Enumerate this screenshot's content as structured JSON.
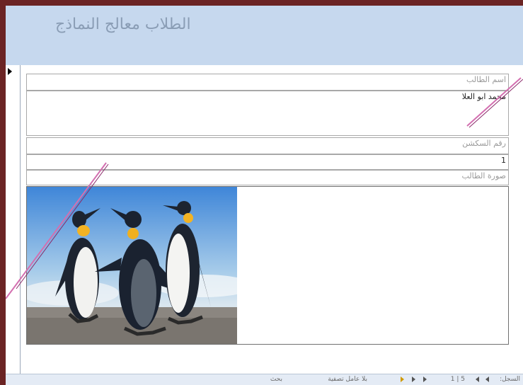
{
  "form": {
    "title": "الطلاب معالج النماذج",
    "fields": [
      {
        "label": "اسم الطالب",
        "value": "محمد ابو العلا"
      },
      {
        "label": "رقم السكشن",
        "value": "1"
      },
      {
        "label": "صورة الطالب"
      }
    ],
    "photo_subject": "penguins-photo"
  },
  "statusbar": {
    "record_label": "السجل:",
    "record_position": "5 | 1",
    "filter_label": "بلا عامل تصفية",
    "search_label": "بحث"
  },
  "colors": {
    "frame": "#6b2424",
    "header": "#c6d8ee",
    "highlight_line": "#d36fb0"
  }
}
